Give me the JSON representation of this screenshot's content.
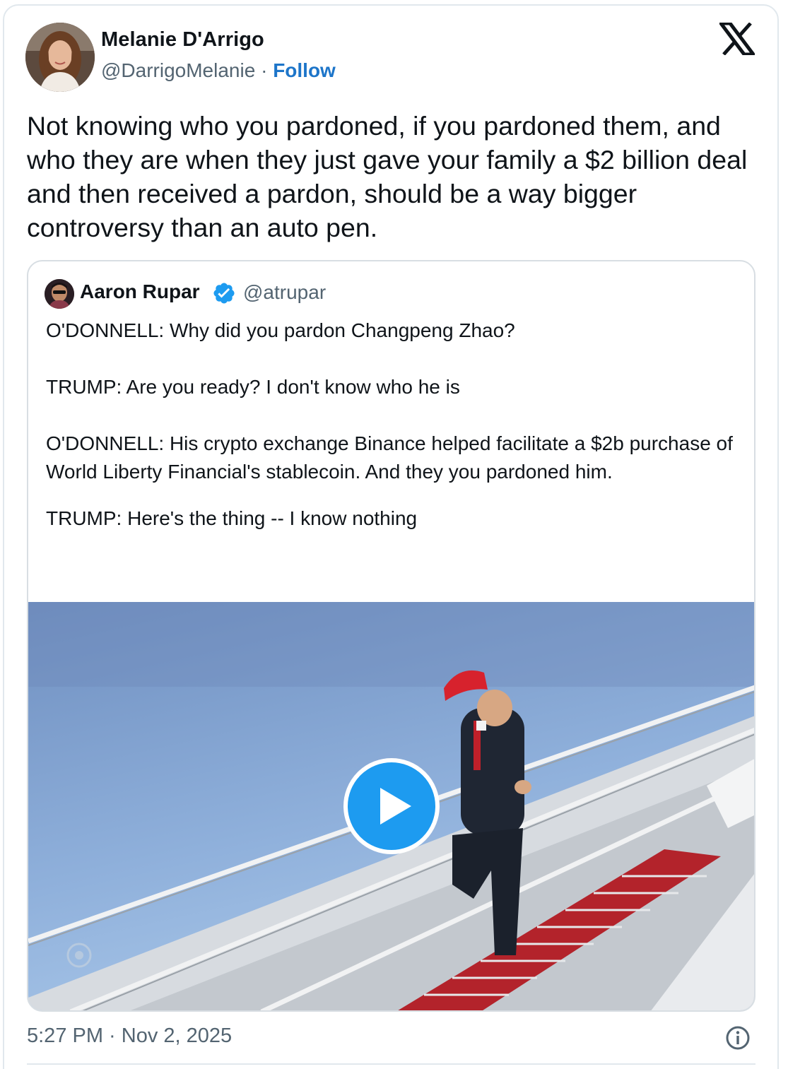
{
  "tweet": {
    "author_name": "Melanie D'Arrigo",
    "author_handle": "@DarrigoMelanie",
    "separator": "·",
    "follow_label": "Follow",
    "text": "Not knowing who you pardoned, if you pardoned them, and who they are when they just gave your family a $2 billion deal and then received a pardon, should be a way bigger controversy than an auto pen.",
    "timestamp": "5:27 PM · Nov 2, 2025"
  },
  "quoted_tweet": {
    "author_name": "Aaron Rupar",
    "author_handle": "@atrupar",
    "verified": true,
    "lines": [
      "O'DONNELL: Why did you pardon Changpeng Zhao?",
      "TRUMP: Are you ready? I don't know who he is",
      "O'DONNELL: His crypto exchange Binance helped facilitate a $2b purchase of World Liberty Financial's stablecoin. And they you pardoned him.",
      "TRUMP: Here's the thing -- I know nothing"
    ]
  },
  "icons": {
    "logo": "x-logo-icon",
    "verified": "verified-badge-icon",
    "play": "play-icon",
    "info": "info-icon"
  },
  "colors": {
    "link_blue": "#1d75c9",
    "verified_blue": "#1d9bf0",
    "secondary_text": "#536471",
    "border": "#e1e8ed"
  }
}
